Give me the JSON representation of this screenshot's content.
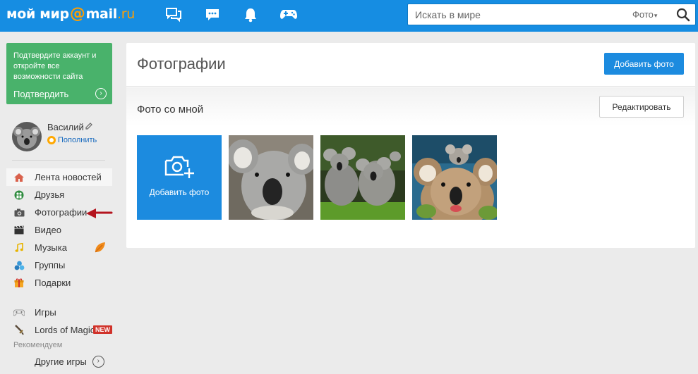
{
  "header": {
    "logo_main": "мой мир",
    "logo_at": "@",
    "logo_mail": "mail",
    "logo_ru": ".ru",
    "nav_icons": [
      "chat-icon",
      "messages-icon",
      "bell-icon",
      "gamepad-icon"
    ],
    "search": {
      "placeholder": "Искать в мире",
      "scope": "Фото"
    }
  },
  "promo": {
    "text": "Подтвердите аккаунт и откройте все возможности сайта",
    "confirm_label": "Подтвердить",
    "color": "#49b26b"
  },
  "profile": {
    "name": "Василий",
    "topup_label": "Пополнить"
  },
  "sidebar": {
    "items": [
      {
        "label": "Лента новостей",
        "icon": "house-icon"
      },
      {
        "label": "Друзья",
        "icon": "friends-icon"
      },
      {
        "label": "Фотографии",
        "icon": "camera-icon"
      },
      {
        "label": "Видео",
        "icon": "clapper-icon"
      },
      {
        "label": "Музыка",
        "icon": "note-icon"
      },
      {
        "label": "Группы",
        "icon": "groups-icon"
      },
      {
        "label": "Подарки",
        "icon": "gift-icon"
      }
    ],
    "games": [
      {
        "label": "Игры",
        "icon": "joystick-icon"
      },
      {
        "label": "Lords of Magic",
        "icon": "sword-icon",
        "badge": "NEW"
      }
    ],
    "recommend_label": "Рекомендуем",
    "other_games_label": "Другие игры"
  },
  "main": {
    "title": "Фотографии",
    "add_photo_button": "Добавить фото",
    "section_title": "Фото со мной",
    "edit_button": "Редактировать",
    "add_tile_label": "Добавить фото"
  },
  "colors": {
    "topbar": "#168de2",
    "accent": "#1c8bdf",
    "logo_accent": "#ff9e00",
    "badge": "#d0322a"
  }
}
